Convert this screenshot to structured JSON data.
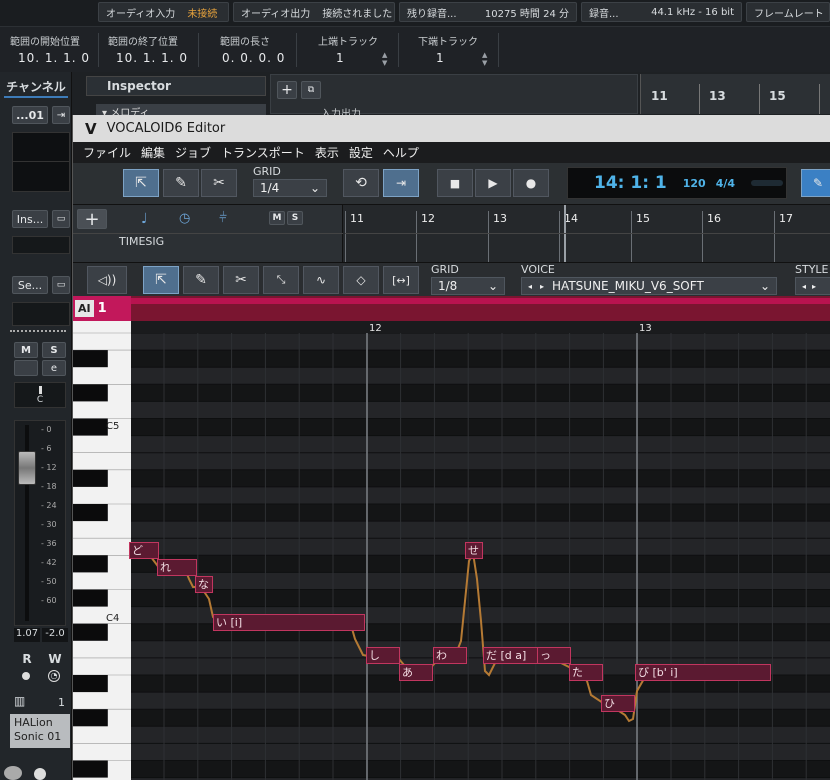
{
  "statusbar": {
    "audio_input_label": "オーディオ入力",
    "audio_input_status": "未接続",
    "audio_output_label": "オーディオ出力",
    "audio_output_status": "接続されました",
    "record_time_label": "残り録音...",
    "record_time_value": "10275 時間 24 分",
    "record_format_label": "録音...",
    "record_format_value": "44.1 kHz - 16 bit",
    "framerate_label": "フレームレート",
    "warning_color": "#e6a23c"
  },
  "range": {
    "start_label": "範囲の開始位置",
    "start_value": "10. 1. 1.   0",
    "end_label": "範囲の終了位置",
    "end_value": "10. 1. 1.   0",
    "length_label": "範囲の長さ",
    "length_value": "0. 0. 0.   0",
    "upper_track_label": "上端トラック",
    "upper_track_value": "1",
    "lower_track_label": "下端トラック",
    "lower_track_value": "1"
  },
  "cubase_ruler": [
    "11",
    "13",
    "15"
  ],
  "channel": {
    "tab": "チャンネル",
    "name_button": "...01",
    "insert_button": "Ins...",
    "send_button": "Se...",
    "mute": "M",
    "solo": "S",
    "pan_label": "C",
    "fader_scale": [
      "0",
      "6",
      "12",
      "18",
      "24",
      "30",
      "36",
      "42",
      "50",
      "60"
    ],
    "level_left": "1.07",
    "level_right": "-2.0",
    "read": "R",
    "write": "W",
    "instrument_number": "1",
    "instrument_name": "HALion Sonic 01"
  },
  "inspector": {
    "title": "Inspector",
    "sub_label": "メロディ",
    "track_panel_label": "入力出力"
  },
  "vocaloid": {
    "title": "VOCALOID6 Editor",
    "menu": [
      "ファイル",
      "編集",
      "ジョブ",
      "トランスポート",
      "表示",
      "設定",
      "ヘルプ"
    ],
    "grid_label": "GRID",
    "grid_value": "1/4",
    "time_position": "14: 1: 1",
    "tempo": "120",
    "time_signature": "4/4",
    "track_mute": "M",
    "track_solo": "S",
    "timesig_label": "TIMESIG",
    "ruler": [
      "11",
      "12",
      "13",
      "14",
      "15",
      "16",
      "17"
    ],
    "piano_grid_label": "GRID",
    "piano_grid_value": "1/8",
    "voice_label": "VOICE",
    "voice_value": "HATSUNE_MIKU_V6_SOFT",
    "style_label": "STYLE",
    "ai_badge": "AI",
    "track_number": "1",
    "piano_ruler": [
      "12",
      "13"
    ],
    "key_labels": [
      "C5",
      "C4"
    ],
    "accent_color": "#c2185b",
    "lcd_color": "#4fb3e8"
  },
  "notes": [
    "ど",
    "れ",
    "な",
    "い [i]",
    "し",
    "あ",
    "わ",
    "せ",
    "だ [d a]",
    "っ",
    "た",
    "ひ",
    "び [b' i]"
  ]
}
